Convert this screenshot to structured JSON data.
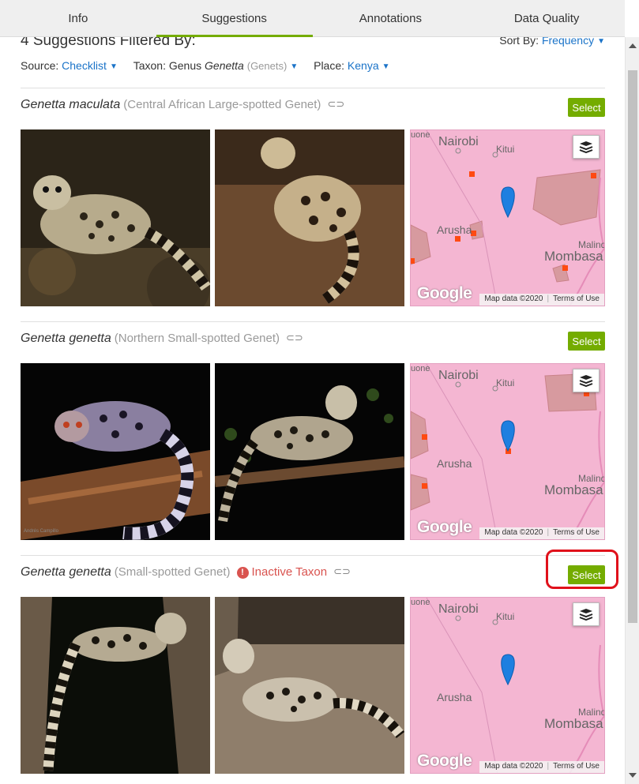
{
  "tabs": [
    {
      "label": "Info"
    },
    {
      "label": "Suggestions"
    },
    {
      "label": "Annotations"
    },
    {
      "label": "Data Quality"
    }
  ],
  "header": {
    "heading": "4 Suggestions Filtered By:",
    "sort_label": "Sort By:",
    "sort_value": "Frequency"
  },
  "filters": {
    "source_label": "Source:",
    "source_value": "Checklist",
    "taxon_label": "Taxon:",
    "taxon_rank": "Genus",
    "taxon_name": "Genetta",
    "taxon_common": "(Genets)",
    "place_label": "Place:",
    "place_value": "Kenya"
  },
  "suggestions": [
    {
      "scientific": "Genetta maculata",
      "common": "(Central African Large-spotted Genet)",
      "select": "Select"
    },
    {
      "scientific": "Genetta genetta",
      "common": "(Northern Small-spotted Genet)",
      "select": "Select"
    },
    {
      "scientific": "Genetta genetta",
      "common": "(Small-spotted Genet)",
      "inactive": "Inactive Taxon",
      "select": "Select"
    }
  ],
  "map": {
    "nairobi": "Nairobi",
    "kitui": "Kitui",
    "arusha": "Arusha",
    "mombasa": "Mombasa",
    "malindi": "Malind",
    "uone": "uone",
    "google": "Google",
    "map_data": "Map data ©2020",
    "terms": "Terms of Use"
  },
  "photo_credit": "Andrés Campillo",
  "colors": {
    "accent": "#74ac00",
    "link": "#1a73c8",
    "warning": "#d9534f",
    "map_bg": "#f4b6d2",
    "marker": "#1e7fe0",
    "highlight": "#e0111b"
  }
}
